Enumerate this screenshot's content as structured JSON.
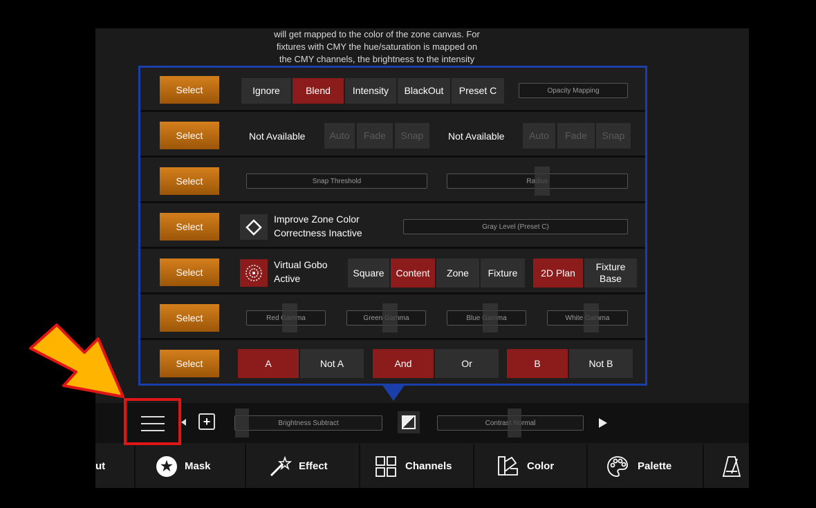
{
  "help_text": {
    "line1": "will get mapped to the color of the zone canvas. For",
    "line2": "fixtures with CMY the hue/saturation is mapped on",
    "line3": "the CMY channels, the brightness to the intensity"
  },
  "select_label": "Select",
  "rows": {
    "opacity": {
      "ignore": "Ignore",
      "blend": "Blend",
      "intensity": "Intensity",
      "blackout": "BlackOut",
      "preset_c": "Preset C",
      "mapping": "Opacity Mapping"
    },
    "transition": {
      "left_status": "Not Available",
      "right_status": "Not Available",
      "auto": "Auto",
      "fade": "Fade",
      "snap": "Snap"
    },
    "snap": {
      "threshold": "Snap Threshold",
      "radius": "Radius"
    },
    "correction": {
      "line1": "Improve Zone Color",
      "line2": "Correctness Inactive",
      "gray_level": "Gray Level (Preset C)"
    },
    "gobo": {
      "line1": "Virtual Gobo",
      "line2": "Active",
      "square": "Square",
      "content": "Content",
      "zone": "Zone",
      "fixture": "Fixture",
      "plan": "2D Plan",
      "base_line1": "Fixture",
      "base_line2": "Base"
    },
    "gamma": {
      "red": "Red Gamma",
      "green": "Green Gamma",
      "blue": "Blue Gamma",
      "white": "White Gamma"
    },
    "logic": {
      "a": "A",
      "not_a": "Not A",
      "and": "And",
      "or": "Or",
      "b": "B",
      "not_b": "Not B"
    }
  },
  "toolbar": {
    "brightness": "Brightness Subtract",
    "contrast": "Contrast Normal"
  },
  "tabs": {
    "partial": "ut",
    "mask": "Mask",
    "effect": "Effect",
    "channels": "Channels",
    "color": "Color",
    "palette": "Palette"
  },
  "colors": {
    "accent_red": "#8c1c1c",
    "select_orange": "#d47f1c",
    "popup_border": "#1a3fa8",
    "annotation_arrow": "#ffb400"
  }
}
